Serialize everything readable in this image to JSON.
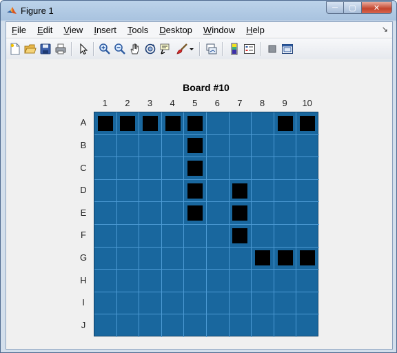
{
  "window": {
    "title": "Figure 1",
    "buttons": {
      "minimize": "─",
      "maximize": "▢",
      "close": "✕"
    }
  },
  "menubar": {
    "items": [
      {
        "key": "File",
        "rest": "ile",
        "u": "F"
      },
      {
        "key": "Edit",
        "rest": "dit",
        "u": "E"
      },
      {
        "key": "View",
        "rest": "iew",
        "u": "V"
      },
      {
        "key": "Insert",
        "rest": "nsert",
        "u": "I"
      },
      {
        "key": "Tools",
        "rest": "ools",
        "u": "T"
      },
      {
        "key": "Desktop",
        "rest": "esktop",
        "u": "D"
      },
      {
        "key": "Window",
        "rest": "indow",
        "u": "W"
      },
      {
        "key": "Help",
        "rest": "elp",
        "u": "H"
      }
    ],
    "dock_arrow": "↘"
  },
  "toolbar": {
    "tools": [
      "new-figure-icon",
      "open-file-icon",
      "save-icon",
      "print-icon",
      "edit-plot-arrow-icon",
      "zoom-in-icon",
      "zoom-out-icon",
      "pan-icon",
      "rotate-3d-icon",
      "data-cursor-icon",
      "brush-icon",
      "brush-dropdown-icon",
      "link-plot-icon",
      "insert-colorbar-icon",
      "insert-legend-icon",
      "hide-plot-tools-icon",
      "show-plot-tools-icon"
    ]
  },
  "board": {
    "title": "Board #10",
    "columns": [
      "1",
      "2",
      "3",
      "4",
      "5",
      "6",
      "7",
      "8",
      "9",
      "10"
    ],
    "rows": [
      "A",
      "B",
      "C",
      "D",
      "E",
      "F",
      "G",
      "H",
      "I",
      "J"
    ],
    "water_color": "#19679e",
    "ship_color": "#000000",
    "occupied_cells": [
      [
        "A",
        "1"
      ],
      [
        "A",
        "2"
      ],
      [
        "A",
        "3"
      ],
      [
        "A",
        "4"
      ],
      [
        "A",
        "5"
      ],
      [
        "A",
        "9"
      ],
      [
        "A",
        "10"
      ],
      [
        "B",
        "5"
      ],
      [
        "C",
        "5"
      ],
      [
        "D",
        "5"
      ],
      [
        "E",
        "5"
      ],
      [
        "D",
        "7"
      ],
      [
        "E",
        "7"
      ],
      [
        "F",
        "7"
      ],
      [
        "G",
        "8"
      ],
      [
        "G",
        "9"
      ],
      [
        "G",
        "10"
      ]
    ]
  }
}
